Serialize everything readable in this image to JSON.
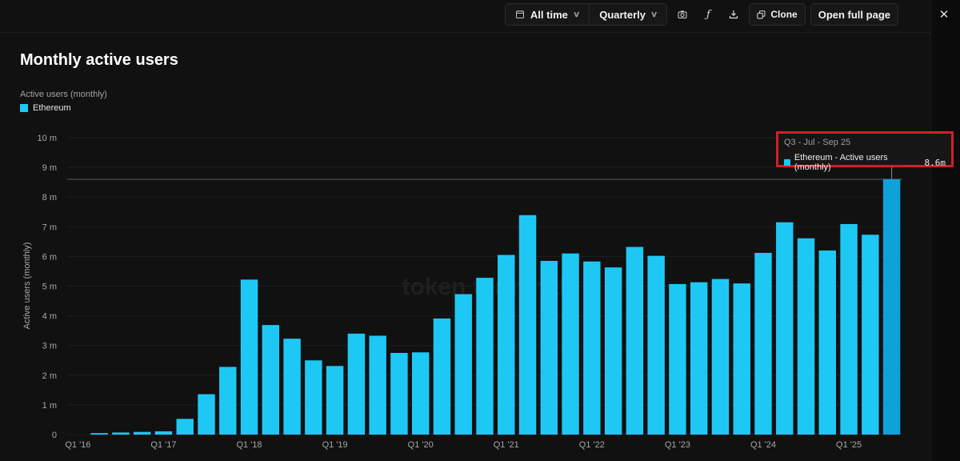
{
  "toolbar": {
    "range_label": "All time",
    "interval_label": "Quarterly",
    "clone_label": "Clone",
    "open_label": "Open full page",
    "icons": [
      "calendar-icon",
      "chevron-down-icon",
      "camera-icon",
      "formula-icon",
      "download-icon",
      "clone-icon",
      "close-icon"
    ]
  },
  "chart": {
    "title": "Monthly active users",
    "subtitle": "Active users (monthly)",
    "legend": "Ethereum",
    "watermark": "token terminal"
  },
  "tooltip": {
    "period": "Q3 - Jul - Sep 25",
    "series_label": "Ethereum - Active users (monthly)",
    "value": "8.6m"
  },
  "colors": {
    "bar": "#1ec8f5",
    "bar_highlight": "#0ea3d8",
    "tooltip_border": "#d21f25"
  },
  "chart_data": {
    "type": "bar",
    "title": "Monthly active users",
    "ylabel": "Active users (monthly)",
    "legend": "top-left",
    "grid": true,
    "ylim": [
      0,
      10
    ],
    "y_ticks": [
      "0",
      "1 m",
      "2 m",
      "3 m",
      "4 m",
      "5 m",
      "6 m",
      "7 m",
      "8 m",
      "9 m",
      "10 m"
    ],
    "x_tick_labels": [
      "Q1 '16",
      "Q1 '17",
      "Q1 '18",
      "Q1 '19",
      "Q1 '20",
      "Q1 '21",
      "Q1 '22",
      "Q1 '23",
      "Q1 '24",
      "Q1 '25"
    ],
    "categories": [
      "Q1 '16",
      "Q2 '16",
      "Q3 '16",
      "Q4 '16",
      "Q1 '17",
      "Q2 '17",
      "Q3 '17",
      "Q4 '17",
      "Q1 '18",
      "Q2 '18",
      "Q3 '18",
      "Q4 '18",
      "Q1 '19",
      "Q2 '19",
      "Q3 '19",
      "Q4 '19",
      "Q1 '20",
      "Q2 '20",
      "Q3 '20",
      "Q4 '20",
      "Q1 '21",
      "Q2 '21",
      "Q3 '21",
      "Q4 '21",
      "Q1 '22",
      "Q2 '22",
      "Q3 '22",
      "Q4 '22",
      "Q1 '23",
      "Q2 '23",
      "Q3 '23",
      "Q4 '23",
      "Q1 '24",
      "Q2 '24",
      "Q3 '24",
      "Q4 '24",
      "Q1 '25",
      "Q2 '25",
      "Q3 '25"
    ],
    "series": [
      {
        "name": "Ethereum",
        "values": [
          0.0,
          0.05,
          0.07,
          0.09,
          0.11,
          0.53,
          1.36,
          2.28,
          5.22,
          3.69,
          3.23,
          2.5,
          2.31,
          3.4,
          3.33,
          2.75,
          2.77,
          3.91,
          4.73,
          5.28,
          6.05,
          7.39,
          5.85,
          6.1,
          5.83,
          5.63,
          6.32,
          6.02,
          5.07,
          5.13,
          5.24,
          5.09,
          6.12,
          7.15,
          6.61,
          6.2,
          7.09,
          6.73,
          8.6
        ]
      }
    ],
    "highlighted": "Q3 '25"
  }
}
